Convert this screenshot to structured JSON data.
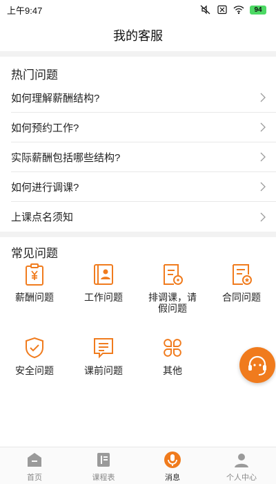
{
  "status": {
    "time": "上午9:47",
    "battery": "94"
  },
  "header": {
    "title": "我的客服"
  },
  "hot": {
    "title": "热门问题",
    "items": [
      {
        "label": "如何理解薪酬结构?"
      },
      {
        "label": "如何预约工作?"
      },
      {
        "label": "实际薪酬包括哪些结构?"
      },
      {
        "label": "如何进行调课?"
      },
      {
        "label": "上课点名须知"
      }
    ]
  },
  "common": {
    "title": "常见问题",
    "items": [
      {
        "label": "薪酬问题",
        "icon": "salary-icon"
      },
      {
        "label": "工作问题",
        "icon": "work-icon"
      },
      {
        "label": "排调课，请假问题",
        "icon": "schedule-leave-icon"
      },
      {
        "label": "合同问题",
        "icon": "contract-icon"
      },
      {
        "label": "安全问题",
        "icon": "safety-icon"
      },
      {
        "label": "课前问题",
        "icon": "pre-class-icon"
      },
      {
        "label": "其他",
        "icon": "other-icon"
      }
    ]
  },
  "tabs": [
    {
      "label": "首页",
      "icon": "home-icon"
    },
    {
      "label": "课程表",
      "icon": "schedule-icon"
    },
    {
      "label": "消息",
      "icon": "message-icon"
    },
    {
      "label": "个人中心",
      "icon": "profile-icon"
    }
  ],
  "colors": {
    "accent": "#f07b1d",
    "divider": "#e8e8e8",
    "background_gap": "#f2f2f2"
  }
}
